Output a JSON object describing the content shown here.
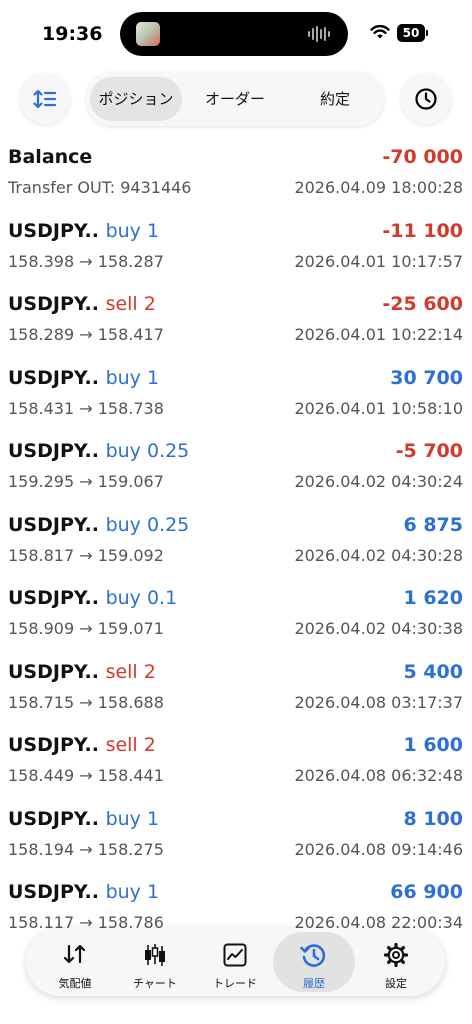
{
  "status_bar": {
    "time": "19:36",
    "battery": "50"
  },
  "toolbar": {
    "tabs": [
      {
        "label": "ポジション",
        "active": true
      },
      {
        "label": "オーダー",
        "active": false
      },
      {
        "label": "約定",
        "active": false
      }
    ]
  },
  "balance": {
    "title": "Balance",
    "amount": "-70 000",
    "description": "Transfer OUT: 9431446",
    "date": "2026.04.09 18:00:28"
  },
  "trades": [
    {
      "symbol": "USDJPY..",
      "side": "buy 1",
      "pl": "-11 100",
      "prices": "158.398 → 158.287",
      "date": "2026.04.01 10:17:57"
    },
    {
      "symbol": "USDJPY..",
      "side": "sell 2",
      "pl": "-25 600",
      "prices": "158.289 → 158.417",
      "date": "2026.04.01 10:22:14"
    },
    {
      "symbol": "USDJPY..",
      "side": "buy 1",
      "pl": "30 700",
      "prices": "158.431 → 158.738",
      "date": "2026.04.01 10:58:10"
    },
    {
      "symbol": "USDJPY..",
      "side": "buy 0.25",
      "pl": "-5 700",
      "prices": "159.295 → 159.067",
      "date": "2026.04.02 04:30:24"
    },
    {
      "symbol": "USDJPY..",
      "side": "buy 0.25",
      "pl": "6 875",
      "prices": "158.817 → 159.092",
      "date": "2026.04.02 04:30:28"
    },
    {
      "symbol": "USDJPY..",
      "side": "buy 0.1",
      "pl": "1 620",
      "prices": "158.909 → 159.071",
      "date": "2026.04.02 04:30:38"
    },
    {
      "symbol": "USDJPY..",
      "side": "sell 2",
      "pl": "5 400",
      "prices": "158.715 → 158.688",
      "date": "2026.04.08 03:17:37"
    },
    {
      "symbol": "USDJPY..",
      "side": "sell 2",
      "pl": "1 600",
      "prices": "158.449 → 158.441",
      "date": "2026.04.08 06:32:48"
    },
    {
      "symbol": "USDJPY..",
      "side": "buy 1",
      "pl": "8 100",
      "prices": "158.194 → 158.275",
      "date": "2026.04.08 09:14:46"
    },
    {
      "symbol": "USDJPY..",
      "side": "buy 1",
      "pl": "66 900",
      "prices": "158.117 → 158.786",
      "date": "2026.04.08 22:00:34"
    }
  ],
  "bottom_nav": [
    {
      "label": "気配値",
      "icon": "quotes-icon",
      "active": false
    },
    {
      "label": "チャート",
      "icon": "chart-candles-icon",
      "active": false
    },
    {
      "label": "トレード",
      "icon": "trade-chart-icon",
      "active": false
    },
    {
      "label": "履歴",
      "icon": "history-icon",
      "active": true
    },
    {
      "label": "設定",
      "icon": "gear-icon",
      "active": false
    }
  ],
  "colors": {
    "buy": "#2d6fd6",
    "sell": "#d13a2c",
    "loss": "#d13a2c",
    "profit": "#2d6fd6",
    "active_nav": "#2d6fd6"
  }
}
